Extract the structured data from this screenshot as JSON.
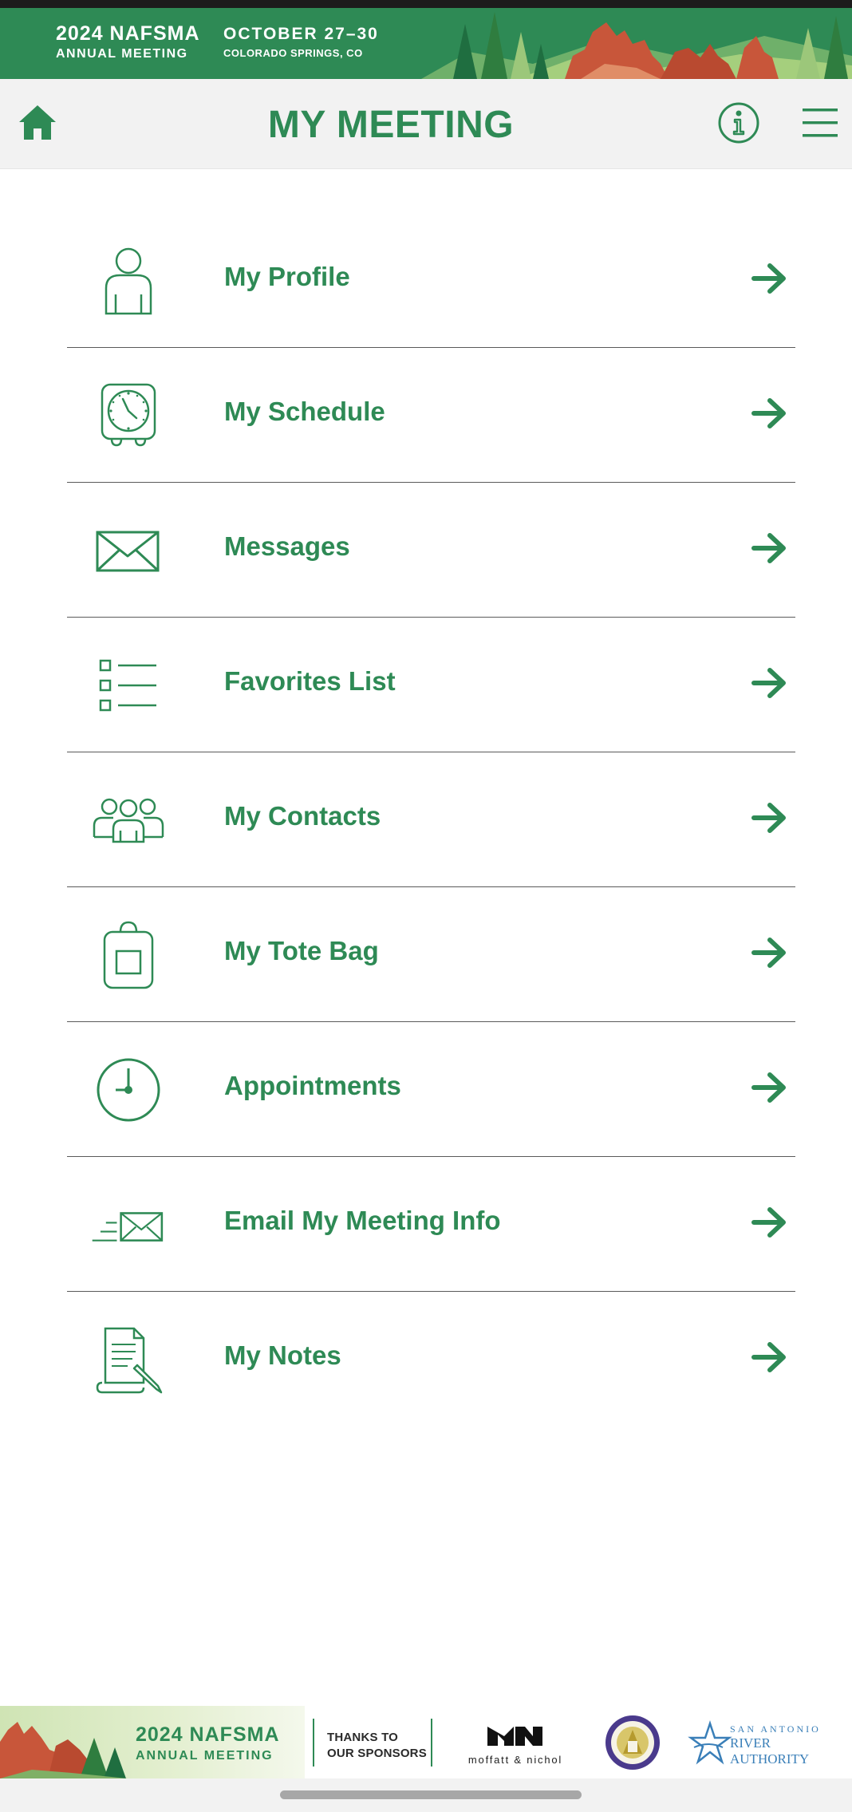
{
  "banner": {
    "title_line1": "2024 NAFSMA",
    "title_line2": "ANNUAL MEETING",
    "date": "OCTOBER 27–30",
    "location": "COLORADO SPRINGS, CO"
  },
  "header": {
    "title": "MY MEETING",
    "home_icon": "home-icon",
    "info_icon": "info-icon",
    "menu_icon": "hamburger-menu-icon"
  },
  "menu": {
    "items": [
      {
        "label": "My Profile",
        "icon": "person-icon"
      },
      {
        "label": "My Schedule",
        "icon": "alarm-clock-icon"
      },
      {
        "label": "Messages",
        "icon": "envelope-icon"
      },
      {
        "label": "Favorites List",
        "icon": "checklist-icon"
      },
      {
        "label": "My Contacts",
        "icon": "group-icon"
      },
      {
        "label": "My Tote Bag",
        "icon": "tote-bag-icon"
      },
      {
        "label": "Appointments",
        "icon": "clock-icon"
      },
      {
        "label": "Email My Meeting Info",
        "icon": "send-mail-icon"
      },
      {
        "label": "My Notes",
        "icon": "notes-icon"
      }
    ]
  },
  "sponsors": {
    "banner_line1": "2024 NAFSMA",
    "banner_line2": "ANNUAL MEETING",
    "thanks_line1": "THANKS TO",
    "thanks_line2": "OUR SPONSORS",
    "moffatt_nichol": "moffatt & nichol",
    "sara_line1": "SAN ANTONIO",
    "sara_line2": "RIVER AUTHORITY"
  },
  "colors": {
    "accent": "#2e8a55",
    "header_bg": "#f2f2f2",
    "divider": "#5a5a5a"
  }
}
